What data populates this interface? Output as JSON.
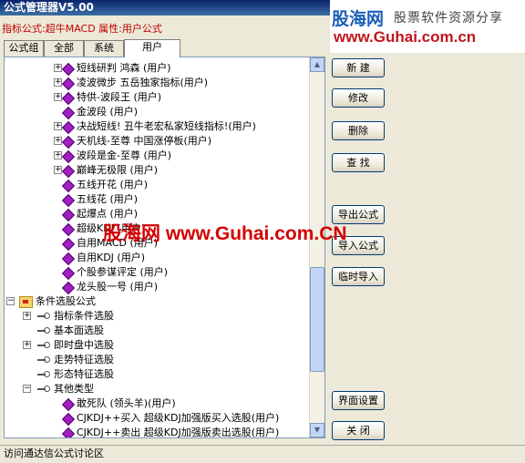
{
  "window": {
    "title": "公式管理器V5.00"
  },
  "banner": {
    "brand": "股海网",
    "tagline": "股票软件资源分享",
    "url": "www.Guhai.com.cn"
  },
  "formula_info": "指标公式:超牛MACD 属性:用户公式",
  "tabs": [
    {
      "label": "公式组",
      "active": false
    },
    {
      "label": "全部",
      "active": false
    },
    {
      "label": "系统",
      "active": false
    },
    {
      "label": "用户",
      "active": true
    }
  ],
  "tree": {
    "items": [
      {
        "label": "短线研判   鸿森 (用户)",
        "indent": 2,
        "icon": "formula",
        "expand": "plus"
      },
      {
        "label": "凌波微步   五岳独家指标(用户)",
        "indent": 2,
        "icon": "formula",
        "expand": "plus"
      },
      {
        "label": "特供-波段王   (用户)",
        "indent": 2,
        "icon": "formula",
        "expand": "plus"
      },
      {
        "label": "金波段   (用户)",
        "indent": 2,
        "icon": "formula",
        "expand": "none"
      },
      {
        "label": "决战短线!   丑牛老宏私家短线指标!(用户)",
        "indent": 2,
        "icon": "formula",
        "expand": "plus"
      },
      {
        "label": "天机线-至尊   中国涨停板(用户)",
        "indent": 2,
        "icon": "formula",
        "expand": "plus"
      },
      {
        "label": "波段是金-至尊   (用户)",
        "indent": 2,
        "icon": "formula",
        "expand": "plus"
      },
      {
        "label": "巅峰无极限   (用户)",
        "indent": 2,
        "icon": "formula",
        "expand": "plus"
      },
      {
        "label": "五线开花   (用户)",
        "indent": 2,
        "icon": "formula",
        "expand": "none"
      },
      {
        "label": "五线花   (用户)",
        "indent": 2,
        "icon": "formula",
        "expand": "none"
      },
      {
        "label": "起爆点   (用户)",
        "indent": 2,
        "icon": "formula",
        "expand": "none"
      },
      {
        "label": "超级KDJ                    (用户)",
        "indent": 2,
        "icon": "formula",
        "expand": "none"
      },
      {
        "label": "自用MACD   (用户)",
        "indent": 2,
        "icon": "formula",
        "expand": "none"
      },
      {
        "label": "自用KDJ   (用户)",
        "indent": 2,
        "icon": "formula",
        "expand": "none"
      },
      {
        "label": "个股参谋评定   (用户)",
        "indent": 2,
        "icon": "formula",
        "expand": "none"
      },
      {
        "label": "龙头股一号   (用户)",
        "indent": 2,
        "icon": "formula",
        "expand": "none"
      },
      {
        "label": "条件选股公式",
        "indent": 0,
        "icon": "folder",
        "expand": "minus"
      },
      {
        "label": "指标条件选股",
        "indent": 1,
        "icon": "key",
        "expand": "plus"
      },
      {
        "label": "基本面选股",
        "indent": 1,
        "icon": "key",
        "expand": "none"
      },
      {
        "label": "即时盘中选股",
        "indent": 1,
        "icon": "key",
        "expand": "plus"
      },
      {
        "label": "走势特征选股",
        "indent": 1,
        "icon": "key",
        "expand": "none"
      },
      {
        "label": "形态特征选股",
        "indent": 1,
        "icon": "key",
        "expand": "none"
      },
      {
        "label": "其他类型",
        "indent": 1,
        "icon": "key",
        "expand": "minus"
      },
      {
        "label": "敢死队   (领头羊)(用户)",
        "indent": 2,
        "icon": "formula",
        "expand": "none"
      },
      {
        "label": "CJKDJ++买入   超级KDJ加强版买入选股(用户)",
        "indent": 2,
        "icon": "formula",
        "expand": "none"
      },
      {
        "label": "CJKDJ++卖出   超级KDJ加强版卖出选股(用户)",
        "indent": 2,
        "icon": "formula",
        "expand": "none"
      }
    ]
  },
  "buttons": {
    "new": "新  建",
    "modify": "修改",
    "delete": "删除",
    "find": "查  找",
    "export": "导出公式",
    "import": "导入公式",
    "temp_import": "临时导入",
    "ui_settings": "界面设置",
    "close": "关  闭"
  },
  "statusbar": "访问通达信公式讨论区",
  "watermark": "股海网 www.Guhai.com.CN"
}
